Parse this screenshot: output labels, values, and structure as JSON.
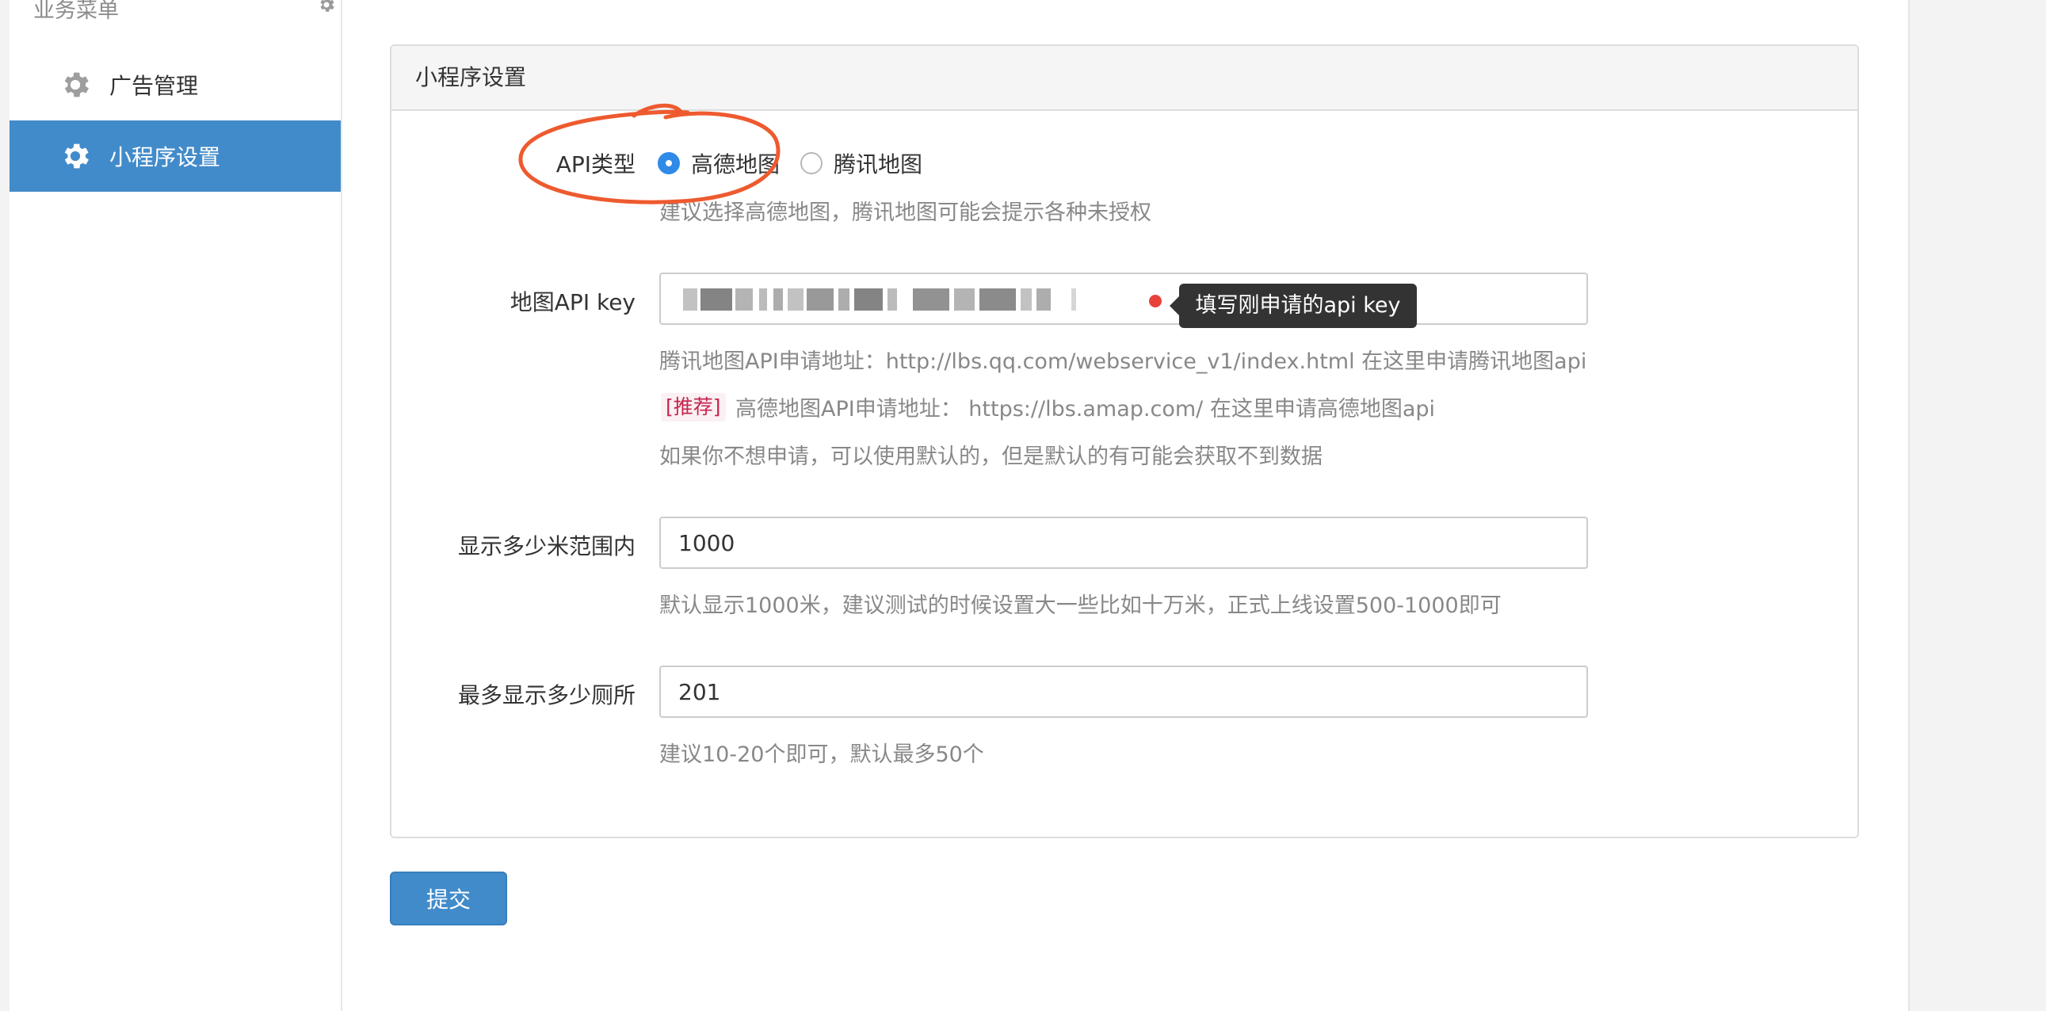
{
  "sidebar": {
    "title": "业务菜单",
    "items": [
      {
        "label": "广告管理",
        "icon": "gear-icon",
        "active": false
      },
      {
        "label": "小程序设置",
        "icon": "gear-icon",
        "active": true
      }
    ]
  },
  "panel": {
    "title": "小程序设置",
    "api_type": {
      "label": "API类型",
      "options": [
        "高德地图",
        "腾讯地图"
      ],
      "selected": "高德地图",
      "help": "建议选择高德地图，腾讯地图可能会提示各种未授权"
    },
    "api_key": {
      "label": "地图API key",
      "tooltip": "填写刚申请的api key",
      "help_tencent": "腾讯地图API申请地址：http://lbs.qq.com/webservice_v1/index.html 在这里申请腾讯地图api",
      "recommend_tag": "[推荐]",
      "help_amap": "高德地图API申请地址： https://lbs.amap.com/ 在这里申请高德地图api",
      "help_default": "如果你不想申请，可以使用默认的，但是默认的有可能会获取不到数据"
    },
    "range": {
      "label": "显示多少米范围内",
      "value": "1000",
      "help": "默认显示1000米，建议测试的时候设置大一些比如十万米，正式上线设置500-1000即可"
    },
    "max_count": {
      "label": "最多显示多少厕所",
      "value": "201",
      "help": "建议10-20个即可，默认最多50个"
    }
  },
  "submit_label": "提交",
  "colors": {
    "primary": "#428bca",
    "annotation": "#ee5a2f",
    "tag_text": "#c7254e",
    "red_dot": "#e8413c"
  }
}
